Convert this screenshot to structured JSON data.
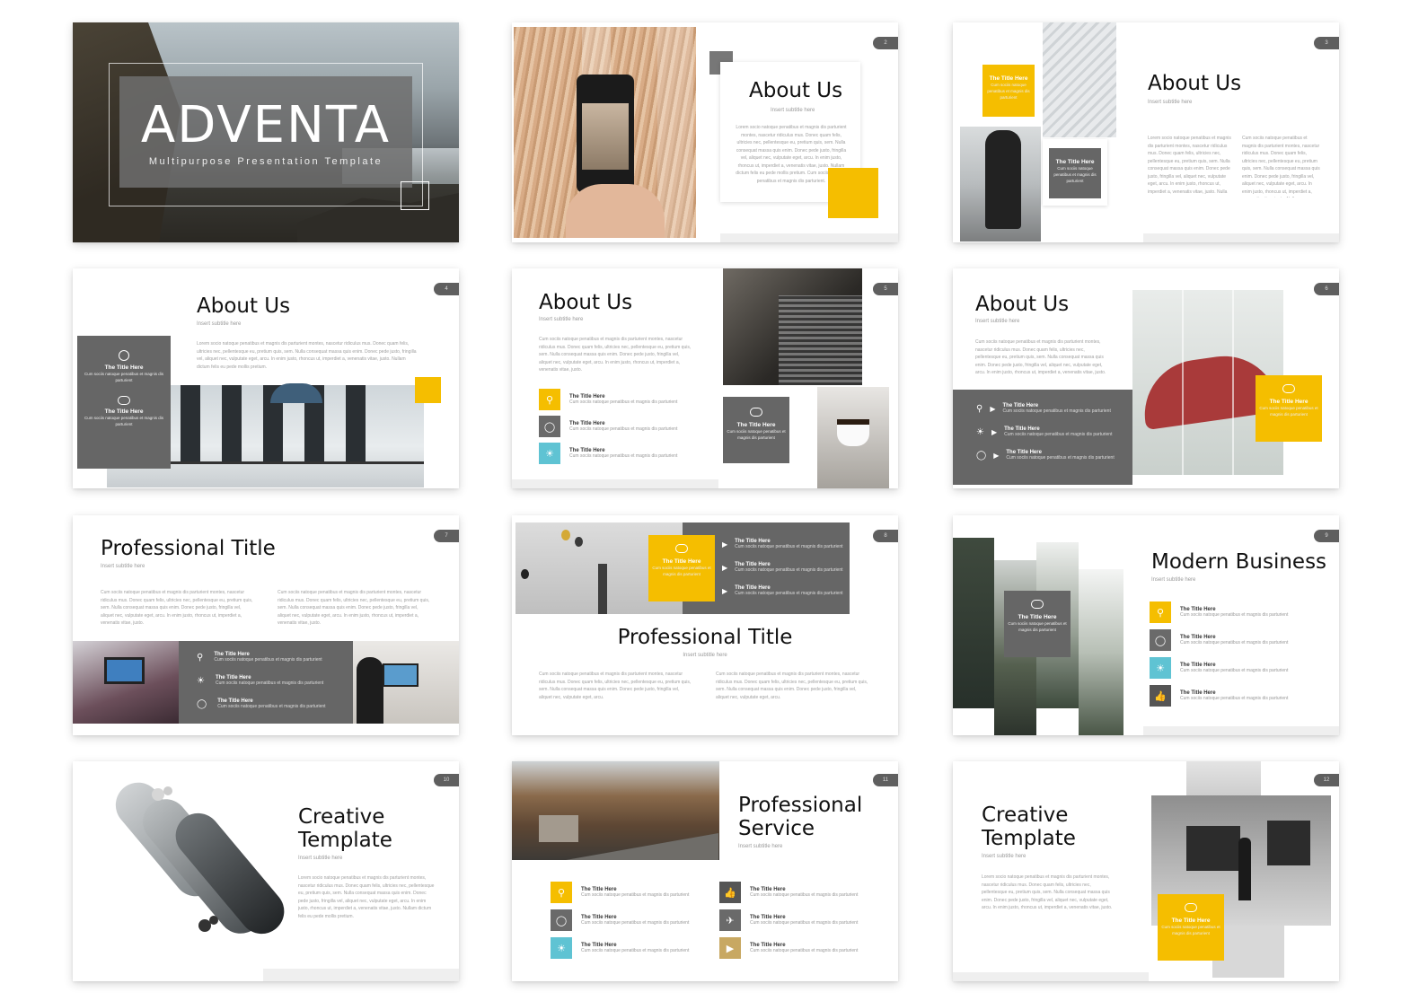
{
  "slides": {
    "s1": {
      "title": "ADVENTA",
      "subtitle": "Multipurpose Presentation Template"
    },
    "s2": {
      "num": "2",
      "title": "About Us",
      "sub": "Insert subtitle here",
      "para": "Lorem socio natoque penatibus et magnis dis parturient montes, nascetur ridiculus mus. Donec quam felis, ultricies nec, pellentesque eu, pretium quis, sem. Nulla consequat massa quis enim. Donec pede justo, fringilla vel, aliquet nec, vulputate eget, arcu. In enim justo, rhoncus ut, imperdiet a, venenatis vitae, justo. Nullam dictum felis eu pede mollis pretium. Cum sociis natoque penatibus et magnis dis parturient."
    },
    "s3": {
      "num": "3",
      "title": "About Us",
      "sub": "Insert subtitle here",
      "box1_title": "The Title Here",
      "box1_desc": "Cum sociis natoque penatibus et magnis dis parturient",
      "box2_title": "The Title Here",
      "box2_desc": "Cum sociis natoque penatibus et magnis dis parturient",
      "col1": "Lorem socio natoque penatibus et magnis dis parturient montes, nascetur ridiculus mus. Donec quam felis, ultricies nec, pellentesque eu, pretium quis, sem. Nulla consequat massa quis enim. Donec pede justo, fringilla vel, aliquet nec, vulputate eget, arcu. In enim justo, rhoncus ut, imperdiet a, venenatis vitae, justo. Nulla",
      "col2": "Cum sociis natoque penatibus et magnis dis parturient montes, nascetur ridiculus mus. Donec quam felis, ultricies nec, pellentesque eu, pretium quis, sem. Nulla consequat massa quis enim. Donec pede justo, fringilla vel, aliquet nec, vulputate eget, arcu. In enim justo, rhoncus ut, imperdiet a, venenatis vitae, justo. Nulla"
    },
    "s4": {
      "num": "4",
      "title": "About Us",
      "sub": "Insert subtitle here",
      "para": "Lorem socio natoque penatibus et magnis dis parturient montes, nascetur ridiculus mus. Donec quam felis, ultricies nec, pellentesque eu, pretium quis, sem. Nulla consequat massa quis enim. Donec pede justo, fringilla vel, aliquet nec, vulputate eget, arcu. In enim justo, rhoncus ut, imperdiet a, venenatis vitae, justo. Nullam dictum felis eu pede mollis pretium.",
      "item1_title": "The Title Here",
      "item1_desc": "Cum sociis natoque penatibus et magnis dis parturient",
      "item2_title": "The Title Here",
      "item2_desc": "Cum sociis natoque penatibus et magnis dis parturient"
    },
    "s5": {
      "num": "5",
      "title": "About Us",
      "sub": "Insert subtitle here",
      "para": "Cum sociis natoque penatibus et magnis dis parturient montes, nascetur ridiculus mus. Donec quam felis, ultricies nec, pellentesque eu, pretium quis, sem. Nulla consequat massa quis enim. Donec pede justo, fringilla vel, aliquet nec, vulputate eget, arcu. In enim justo, rhoncus ut, imperdiet a, venenatis vitae, justo.",
      "items": [
        {
          "title": "The Title Here",
          "desc": "Cum sociis natoque penatibus et magnis dis parturient"
        },
        {
          "title": "The Title Here",
          "desc": "Cum sociis natoque penatibus et magnis dis parturient"
        },
        {
          "title": "The Title Here",
          "desc": "Cum sociis natoque penatibus et magnis dis parturient"
        }
      ],
      "box_title": "The Title Here",
      "box_desc": "Cum sociis natoque penatibus et magnis dis parturient"
    },
    "s6": {
      "num": "6",
      "title": "About Us",
      "sub": "Insert subtitle here",
      "para": "Cum sociis natoque penatibus et magnis dis parturient montes, nascetur ridiculus mus. Donec quam felis, ultricies nec, pellentesque eu, pretium quis, sem. Nulla consequat massa quis enim. Donec pede justo, fringilla vel, aliquet nec, vulputate eget, arcu. In enim justo, rhoncus ut, imperdiet a, venenatis vitae, justo.",
      "items": [
        {
          "title": "The Title Here",
          "desc": "Cum sociis natoque penatibus et magnis dis parturient"
        },
        {
          "title": "The Title Here",
          "desc": "Cum sociis natoque penatibus et magnis dis parturient"
        },
        {
          "title": "The Title Here",
          "desc": "Cum sociis natoque penatibus et magnis dis parturient"
        }
      ],
      "box_title": "The Title Here",
      "box_desc": "Cum sociis natoque penatibus et magnis dis parturient"
    },
    "s7": {
      "num": "7",
      "title": "Professional Title",
      "sub": "Insert subtitle here",
      "col1": "Cum sociis natoque penatibus et magnis dis parturient montes, nascetur ridiculus mus. Donec quam felis, ultricies nec, pellentesque eu, pretium quis, sem. Nulla consequat massa quis enim. Donec pede justo, fringilla vel, aliquet nec, vulputate eget, arcu. In enim justo, rhoncus ut, imperdiet a, venenatis vitae, justo.",
      "col2": "Cum sociis natoque penatibus et magnis dis parturient montes, nascetur ridiculus mus. Donec quam felis, ultricies nec, pellentesque eu, pretium quis, sem. Nulla consequat massa quis enim. Donec pede justo, fringilla vel, aliquet nec, vulputate eget, arcu. In enim justo, rhoncus ut, imperdiet a, venenatis vitae, justo.",
      "items": [
        {
          "title": "The Title Here",
          "desc": "Cum sociis natoque penatibus et magnis dis parturient"
        },
        {
          "title": "The Title Here",
          "desc": "Cum sociis natoque penatibus et magnis dis parturient"
        },
        {
          "title": "The Title Here",
          "desc": "Cum sociis natoque penatibus et magnis dis parturient"
        }
      ]
    },
    "s8": {
      "num": "8",
      "title": "Professional Title",
      "sub": "Insert subtitle here",
      "box_title": "The Title Here",
      "box_desc": "Cum sociis natoque penatibus et magnis dis parturient",
      "items": [
        {
          "title": "The Title Here",
          "desc": "Cum sociis natoque penatibus et magnis dis parturient"
        },
        {
          "title": "The Title Here",
          "desc": "Cum sociis natoque penatibus et magnis dis parturient"
        },
        {
          "title": "The Title Here",
          "desc": "Cum sociis natoque penatibus et magnis dis parturient"
        }
      ],
      "col1": "Cum sociis natoque penatibus et magnis dis parturient montes, nascetur ridiculus mus. Donec quam felis, ultricies nec, pellentesque eu, pretium quis, sem. Nulla consequat massa quis enim. Donec pede justo, fringilla vel, aliquet nec, vulputate eget, arcu.",
      "col2": "Cum sociis natoque penatibus et magnis dis parturient montes, nascetur ridiculus mus. Donec quam felis, ultricies nec, pellentesque eu, pretium quis, sem. Nulla consequat massa quis enim. Donec pede justo, fringilla vel, aliquet nec, vulputate eget, arcu."
    },
    "s9": {
      "num": "9",
      "title": "Modern Business",
      "sub": "Insert subtitle here",
      "box_title": "The Title Here",
      "box_desc": "Cum sociis natoque penatibus et magnis dis parturient",
      "items": [
        {
          "title": "The Title Here",
          "desc": "Cum sociis natoque penatibus et magnis dis parturient"
        },
        {
          "title": "The Title Here",
          "desc": "Cum sociis natoque penatibus et magnis dis parturient"
        },
        {
          "title": "The Title Here",
          "desc": "Cum sociis natoque penatibus et magnis dis parturient"
        },
        {
          "title": "The Title Here",
          "desc": "Cum sociis natoque penatibus et magnis dis parturient"
        }
      ]
    },
    "s10": {
      "num": "10",
      "title_line1": "Creative",
      "title_line2": "Template",
      "sub": "Insert subtitle here",
      "para": "Lorem socio natoque penatibus et magnis dis parturient montes, nascetur ridiculus mus. Donec quam felis, ultricies nec, pellentesque eu, pretium quis, sem. Nulla consequat massa quis enim. Donec pede justo, fringilla vel, aliquet nec, vulputate eget, arcu. In enim justo, rhoncus ut, imperdiet a, venenatis vitae, justo. Nullam dictum felis eu pede mollis pretium."
    },
    "s11": {
      "num": "11",
      "title_line1": "Professional",
      "title_line2": "Service",
      "sub": "Insert subtitle here",
      "items": [
        {
          "title": "The Title Here",
          "desc": "Cum sociis natoque penatibus et magnis dis parturient"
        },
        {
          "title": "The Title Here",
          "desc": "Cum sociis natoque penatibus et magnis dis parturient"
        },
        {
          "title": "The Title Here",
          "desc": "Cum sociis natoque penatibus et magnis dis parturient"
        },
        {
          "title": "The Title Here",
          "desc": "Cum sociis natoque penatibus et magnis dis parturient"
        },
        {
          "title": "The Title Here",
          "desc": "Cum sociis natoque penatibus et magnis dis parturient"
        },
        {
          "title": "The Title Here",
          "desc": "Cum sociis natoque penatibus et magnis dis parturient"
        }
      ]
    },
    "s12": {
      "num": "12",
      "title_line1": "Creative",
      "title_line2": "Template",
      "sub": "Insert subtitle here",
      "para": "Lorem socio natoque penatibus et magnis dis parturient montes, nascetur ridiculus mus. Donec quam felis, ultricies nec, pellentesque eu, pretium quis, sem. Nulla consequat massa quis enim. Donec pede justo, fringilla vel, aliquet nec, vulputate eget, arcu. In enim justo, rhoncus ut, imperdiet a, venenatis vitae, justo.",
      "box_title": "The Title Here",
      "box_desc": "Cum sociis natoque penatibus et magnis dis parturient"
    }
  },
  "colors": {
    "accent": "#f5be00",
    "gray": "#666666",
    "cyan": "#5fc3d3",
    "tan": "#c8a862"
  },
  "icons": [
    "search-icon",
    "lightbulb-icon",
    "sun-icon",
    "thumbs-up-icon",
    "plane-icon",
    "megaphone-icon",
    "chat-icon",
    "clock-icon",
    "play-icon"
  ]
}
